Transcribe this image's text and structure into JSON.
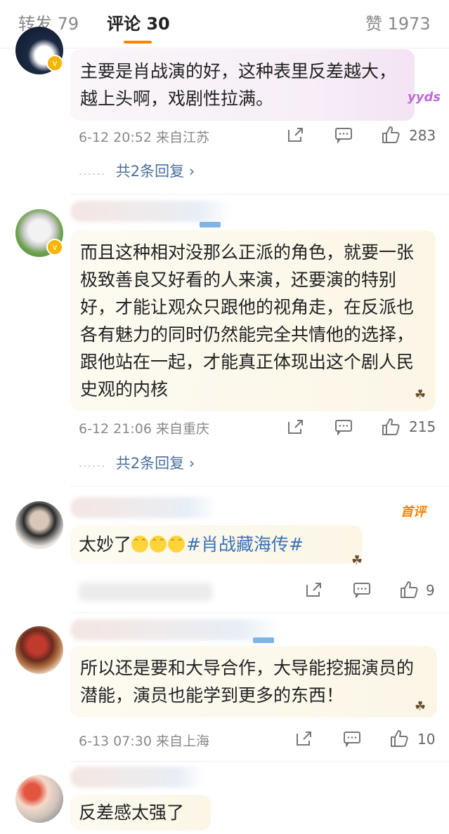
{
  "tabs": [
    {
      "label": "转发 79"
    },
    {
      "label": "评论 30"
    },
    {
      "label": "赞 1973"
    }
  ],
  "colors": {
    "accent": "#ff8200",
    "link": "#3b72b5"
  },
  "comments": [
    {
      "text": "主要是肖战演的好，这种表里反差越大，越上头啊，戏剧性拉满。",
      "decoration": "yyds",
      "time": "6-12 20:52",
      "location": "来自江苏",
      "likes": "283",
      "replies": "共2条回复"
    },
    {
      "text": "而且这种相对没那么正派的角色，就要一张极致善良又好看的人来演，还要演的特别好，才能让观众只跟他的视角走，在反派也各有魅力的同时仍然能完全共情他的选择，跟他站在一起，才能真正体现出这个剧人民史观的内核",
      "time": "6-12 21:06",
      "location": "来自重庆",
      "likes": "215",
      "replies": "共2条回复"
    },
    {
      "text_prefix": "太妙了",
      "hashtag": "#肖战藏海传#",
      "badge": "首评",
      "likes": "9"
    },
    {
      "text": "所以还是要和大导合作，大导能挖掘演员的潜能，演员也能学到更多的东西！",
      "time": "6-13 07:30",
      "location": "来自上海",
      "likes": "10"
    },
    {
      "text": "反差感太强了"
    }
  ],
  "icons": [
    "share-icon",
    "comment-icon",
    "thumbs-up-icon",
    "chevron-right-icon",
    "verified-badge-icon"
  ]
}
